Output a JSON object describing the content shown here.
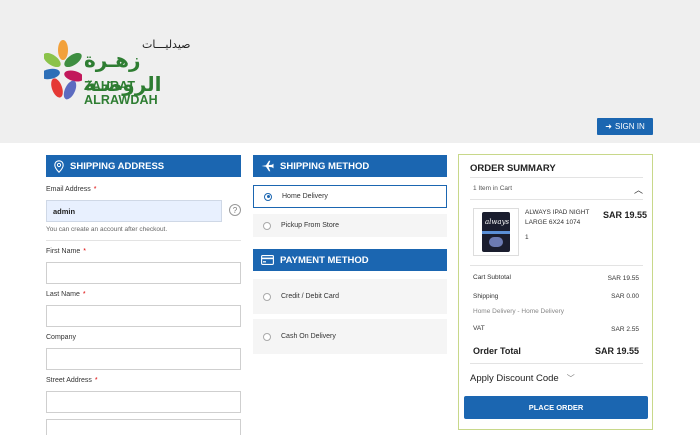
{
  "header": {
    "logo_arabic_small": "صيدليـــات",
    "logo_arabic_big": "زهـرة الروضـة",
    "logo_english": "ZAHRAT ALRAWDAH",
    "signin_label": "SIGN IN"
  },
  "shipping_address": {
    "title": "SHIPPING ADDRESS",
    "email_label": "Email Address",
    "email_value": "admin",
    "email_hint": "You can create an account after checkout.",
    "help_glyph": "?",
    "first_name_label": "First Name",
    "last_name_label": "Last Name",
    "company_label": "Company",
    "street_label": "Street Address",
    "required_mark": "*"
  },
  "shipping_method": {
    "title": "SHIPPING METHOD",
    "options": [
      {
        "label": "Home Delivery",
        "selected": true
      },
      {
        "label": "Pickup From Store",
        "selected": false
      }
    ]
  },
  "payment_method": {
    "title": "PAYMENT METHOD",
    "options": [
      {
        "label": "Credit / Debit Card",
        "selected": false
      },
      {
        "label": "Cash On Delivery",
        "selected": false
      }
    ]
  },
  "order_summary": {
    "title": "ORDER SUMMARY",
    "items_count": "1 Item in Cart",
    "product": {
      "name": "ALWAYS IPAD NIGHT LARGE 6X24 1074",
      "qty": "1",
      "price": "SAR 19.55",
      "image_brand": "always"
    },
    "cart_subtotal_label": "Cart Subtotal",
    "cart_subtotal_value": "SAR 19.55",
    "shipping_label": "Shipping",
    "shipping_value": "SAR 0.00",
    "shipping_method_text": "Home Delivery - Home Delivery",
    "vat_label": "VAT",
    "vat_value": "SAR 2.55",
    "total_label": "Order Total",
    "total_value": "SAR 19.55",
    "discount_label": "Apply Discount Code",
    "place_order_label": "PLACE ORDER"
  },
  "colors": {
    "accent": "#1b66b1",
    "summary_border": "#c8d88a",
    "header_bg": "#efefef"
  }
}
